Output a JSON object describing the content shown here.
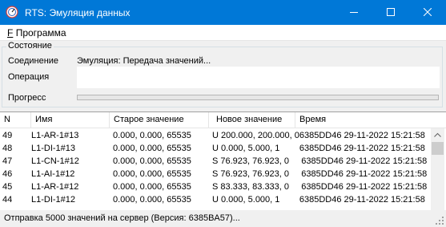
{
  "window": {
    "title": "RTS: Эмуляция данных"
  },
  "menu": {
    "items": [
      {
        "label": "Программа"
      }
    ]
  },
  "status_group": {
    "title": "Состояние",
    "connection_label": "Соединение",
    "connection_value": "Эмуляция: Передача значений...",
    "operation_label": "Операция",
    "operation_value": "",
    "progress_label": "Прогресс",
    "progress_value": 0
  },
  "table": {
    "columns": [
      "N",
      "Имя",
      "Старое значение",
      "Новое значение",
      "Время"
    ],
    "rows": [
      {
        "n": "49",
        "name": "L1-AR-1#13",
        "old": "0.000, 0.000, 65535",
        "new_time": "U 200.000, 200.000, 06385DD46 29-11-2022 15:21:58"
      },
      {
        "n": "48",
        "name": "L1-DI-1#13",
        "old": "0.000, 0.000, 65535",
        "new_time": "U 0.000, 5.000, 1        6385DD46 29-11-2022 15:21:58"
      },
      {
        "n": "47",
        "name": "L1-CN-1#12",
        "old": "0.000, 0.000, 65535",
        "new_time": "S 76.923, 76.923, 0     6385DD46 29-11-2022 15:21:58"
      },
      {
        "n": "46",
        "name": "L1-AI-1#12",
        "old": "0.000, 0.000, 65535",
        "new_time": "S 76.923, 76.923, 0     6385DD46 29-11-2022 15:21:58"
      },
      {
        "n": "45",
        "name": "L1-AR-1#12",
        "old": "0.000, 0.000, 65535",
        "new_time": "S 83.333, 83.333, 0     6385DD46 29-11-2022 15:21:58"
      },
      {
        "n": "44",
        "name": "L1-DI-1#12",
        "old": "0.000, 0.000, 65535",
        "new_time": "U 0.000, 5.000, 1        6385DD46 29-11-2022 15:21:58"
      }
    ]
  },
  "statusbar": {
    "text": "Отправка 5000 значений на сервер (Версия: 6385BA57)..."
  }
}
